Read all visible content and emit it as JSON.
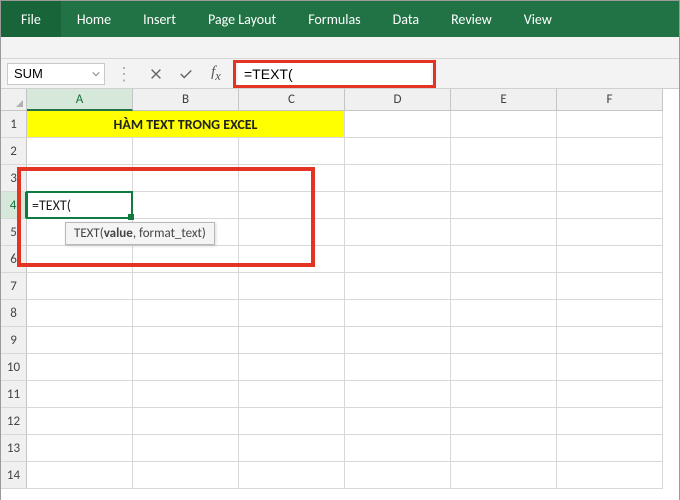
{
  "ribbon": {
    "file": "File",
    "home": "Home",
    "insert": "Insert",
    "layout": "Page Layout",
    "formulas": "Formulas",
    "data": "Data",
    "review": "Review",
    "view": "View"
  },
  "namebox": {
    "value": "SUM"
  },
  "formula_bar": {
    "value": "=TEXT("
  },
  "columns": [
    "A",
    "B",
    "C",
    "D",
    "E",
    "F"
  ],
  "rows": [
    "1",
    "2",
    "3",
    "4",
    "5",
    "6",
    "7",
    "8",
    "9",
    "10",
    "11",
    "12",
    "13",
    "14"
  ],
  "active_row_index": 3,
  "active_col_index": 0,
  "title_cell": {
    "text": "HÀM TEXT TRONG EXCEL"
  },
  "active_cell": {
    "text": "=TEXT("
  },
  "tooltip": {
    "fn": "TEXT(",
    "arg_active": "value",
    "rest": ", format_text)"
  },
  "colors": {
    "ribbon_green": "#217346",
    "highlight_red": "#e23323",
    "yellow": "#ffff00",
    "cell_border_green": "#0f7b40"
  }
}
